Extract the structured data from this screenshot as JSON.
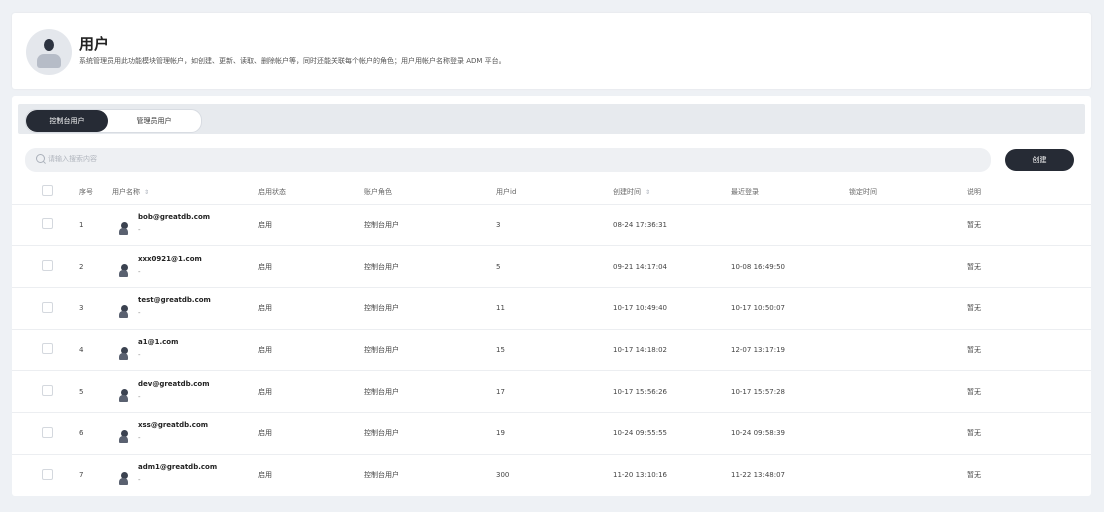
{
  "header": {
    "title": "用户",
    "description": "系统管理员用此功能模块管理帐户，如创建、更新、读取、删除帐户等，同时还能关联每个帐户的角色；用户用帐户名称登录 ADM 平台。"
  },
  "tabs": [
    {
      "label": "控制台用户",
      "active": true
    },
    {
      "label": "管理员用户",
      "active": false
    }
  ],
  "search": {
    "placeholder": "请输入搜索内容",
    "value": ""
  },
  "create_label": "创建",
  "table": {
    "columns": [
      "序号",
      "用户名称",
      "启用状态",
      "账户角色",
      "用户id",
      "创建时间",
      "最近登录",
      "锁定时间",
      "说明"
    ],
    "rows": [
      {
        "index": "1",
        "name": "bob@greatdb.com",
        "sub": "-",
        "status": "启用",
        "role": "控制台用户",
        "uid": "3",
        "created": "08-24 17:36:31",
        "last_login": "",
        "locked": "",
        "note": "暂无"
      },
      {
        "index": "2",
        "name": "xxx0921@1.com",
        "sub": "-",
        "status": "启用",
        "role": "控制台用户",
        "uid": "5",
        "created": "09-21 14:17:04",
        "last_login": "10-08 16:49:50",
        "locked": "",
        "note": "暂无"
      },
      {
        "index": "3",
        "name": "test@greatdb.com",
        "sub": "-",
        "status": "启用",
        "role": "控制台用户",
        "uid": "11",
        "created": "10-17 10:49:40",
        "last_login": "10-17 10:50:07",
        "locked": "",
        "note": "暂无"
      },
      {
        "index": "4",
        "name": "a1@1.com",
        "sub": "-",
        "status": "启用",
        "role": "控制台用户",
        "uid": "15",
        "created": "10-17 14:18:02",
        "last_login": "12-07 13:17:19",
        "locked": "",
        "note": "暂无"
      },
      {
        "index": "5",
        "name": "dev@greatdb.com",
        "sub": "-",
        "status": "启用",
        "role": "控制台用户",
        "uid": "17",
        "created": "10-17 15:56:26",
        "last_login": "10-17 15:57:28",
        "locked": "",
        "note": "暂无"
      },
      {
        "index": "6",
        "name": "xss@greatdb.com",
        "sub": "-",
        "status": "启用",
        "role": "控制台用户",
        "uid": "19",
        "created": "10-24 09:55:55",
        "last_login": "10-24 09:58:39",
        "locked": "",
        "note": "暂无"
      },
      {
        "index": "7",
        "name": "adm1@greatdb.com",
        "sub": "-",
        "status": "启用",
        "role": "控制台用户",
        "uid": "300",
        "created": "11-20 13:10:16",
        "last_login": "11-22 13:48:07",
        "locked": "",
        "note": "暂无"
      }
    ]
  },
  "icons": {
    "header": "user-avatar-icon",
    "search": "search-icon",
    "row": "user-avatar-icon",
    "sort": "sort-icon"
  },
  "colors": {
    "dark": "#262b35",
    "page_bg": "#eef1f5",
    "search_bg": "#eef0f3"
  }
}
